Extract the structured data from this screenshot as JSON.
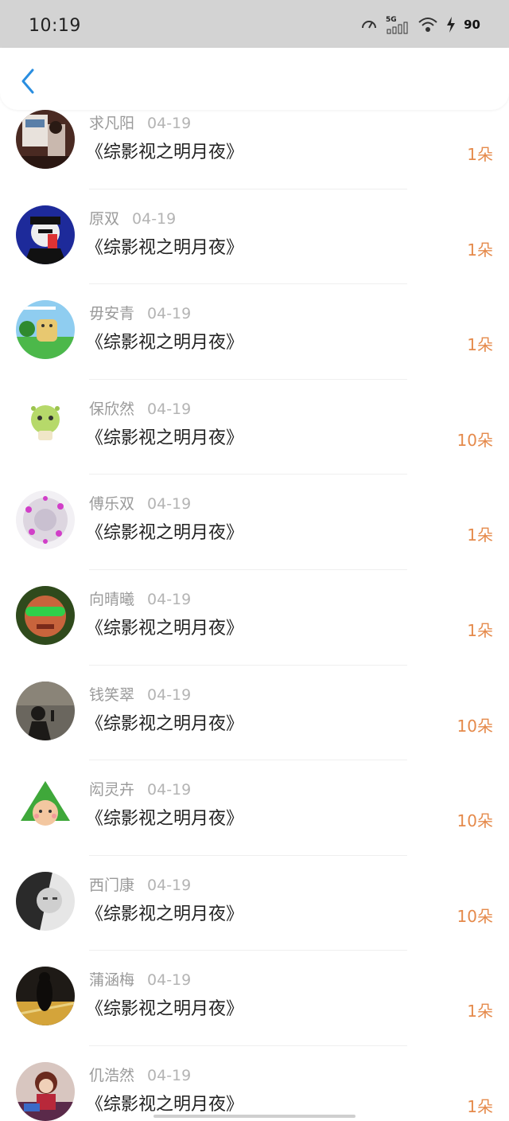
{
  "status_bar": {
    "time": "10:19",
    "network": "5G",
    "battery": "90"
  },
  "header": {
    "back_icon": "chevron-left-icon",
    "back_color": "#2a8ee0"
  },
  "colors": {
    "amount": "#e58a4b",
    "name": "#9a9a9a",
    "title": "#222222"
  },
  "gifts": [
    {
      "name": "求凡阳",
      "date": "04-19",
      "title": "《综影视之明月夜》",
      "amount": "1朵"
    },
    {
      "name": "原双",
      "date": "04-19",
      "title": "《综影视之明月夜》",
      "amount": "1朵"
    },
    {
      "name": "毋安青",
      "date": "04-19",
      "title": "《综影视之明月夜》",
      "amount": "1朵"
    },
    {
      "name": "保欣然",
      "date": "04-19",
      "title": "《综影视之明月夜》",
      "amount": "10朵"
    },
    {
      "name": "傅乐双",
      "date": "04-19",
      "title": "《综影视之明月夜》",
      "amount": "1朵"
    },
    {
      "name": "向晴曦",
      "date": "04-19",
      "title": "《综影视之明月夜》",
      "amount": "1朵"
    },
    {
      "name": "钱笑翠",
      "date": "04-19",
      "title": "《综影视之明月夜》",
      "amount": "10朵"
    },
    {
      "name": "闳灵卉",
      "date": "04-19",
      "title": "《综影视之明月夜》",
      "amount": "10朵"
    },
    {
      "name": "西门康",
      "date": "04-19",
      "title": "《综影视之明月夜》",
      "amount": "10朵"
    },
    {
      "name": "蒲涵梅",
      "date": "04-19",
      "title": "《综影视之明月夜》",
      "amount": "1朵"
    },
    {
      "name": "仉浩然",
      "date": "04-19",
      "title": "《综影视之明月夜》",
      "amount": "1朵"
    }
  ]
}
